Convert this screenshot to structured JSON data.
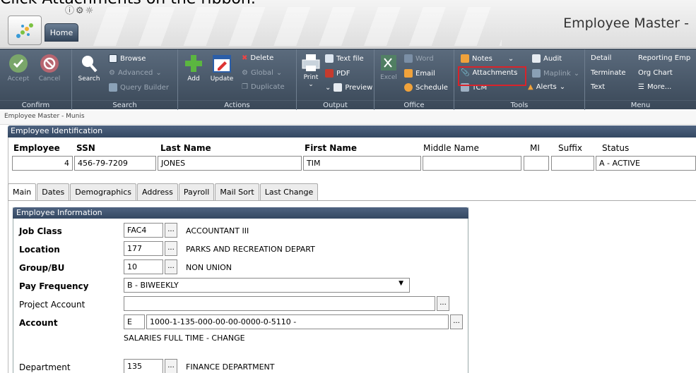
{
  "instruction": "Click Attachments on the ribbon.",
  "app": {
    "title": "Employee Master -",
    "home_tab": "Home"
  },
  "ribbon": {
    "confirm": {
      "label": "Confirm",
      "accept": "Accept",
      "cancel": "Cancel"
    },
    "search": {
      "label": "Search",
      "search": "Search",
      "browse": "Browse",
      "advanced": "Advanced",
      "query_builder": "Query Builder"
    },
    "actions": {
      "label": "Actions",
      "add": "Add",
      "update": "Update",
      "delete": "Delete",
      "global": "Global",
      "duplicate": "Duplicate"
    },
    "output": {
      "label": "Output",
      "print": "Print",
      "text_file": "Text file",
      "pdf": "PDF",
      "preview": "Preview"
    },
    "office": {
      "label": "Office",
      "excel": "Excel",
      "word": "Word",
      "email": "Email",
      "schedule": "Schedule"
    },
    "tools": {
      "label": "Tools",
      "notes": "Notes",
      "audit": "Audit",
      "attachments": "Attachments",
      "maplink": "Maplink",
      "tcm": "TCM",
      "alerts": "Alerts"
    },
    "menu": {
      "label": "Menu",
      "detail": "Detail",
      "terminate": "Terminate",
      "text": "Text",
      "reporting": "Reporting Emp",
      "org_chart": "Org Chart",
      "more": "More..."
    }
  },
  "breadcrumb": "Employee Master - Munis",
  "identification": {
    "title": "Employee Identification",
    "headers": {
      "employee": "Employee",
      "ssn": "SSN",
      "last_name": "Last Name",
      "first_name": "First Name",
      "middle_name": "Middle Name",
      "mi": "MI",
      "suffix": "Suffix",
      "status": "Status"
    },
    "values": {
      "employee": "4",
      "ssn": "456-79-7209",
      "last_name": "JONES",
      "first_name": "TIM",
      "middle_name": "",
      "mi": "",
      "suffix": "",
      "status": "A - ACTIVE"
    }
  },
  "tabs": [
    "Main",
    "Dates",
    "Demographics",
    "Address",
    "Payroll",
    "Mail Sort",
    "Last Change"
  ],
  "info": {
    "title": "Employee Information",
    "job_class": {
      "label": "Job Class",
      "code": "FAC4",
      "desc": "ACCOUNTANT III"
    },
    "location": {
      "label": "Location",
      "code": "177",
      "desc": "PARKS AND RECREATION DEPART"
    },
    "group": {
      "label": "Group/BU",
      "code": "10",
      "desc": "NON UNION"
    },
    "pay_frequency": {
      "label": "Pay Frequency",
      "value": "B - BIWEEKLY"
    },
    "project_account": {
      "label": "Project Account",
      "value": ""
    },
    "account": {
      "label": "Account",
      "code": "E",
      "value": "1000-1-135-000-00-00-0000-0-5110  -",
      "desc": "SALARIES FULL TIME - CHANGE"
    },
    "department": {
      "label": "Department",
      "code": "135",
      "desc": "FINANCE DEPARTMENT"
    }
  },
  "ellipsis": "..."
}
